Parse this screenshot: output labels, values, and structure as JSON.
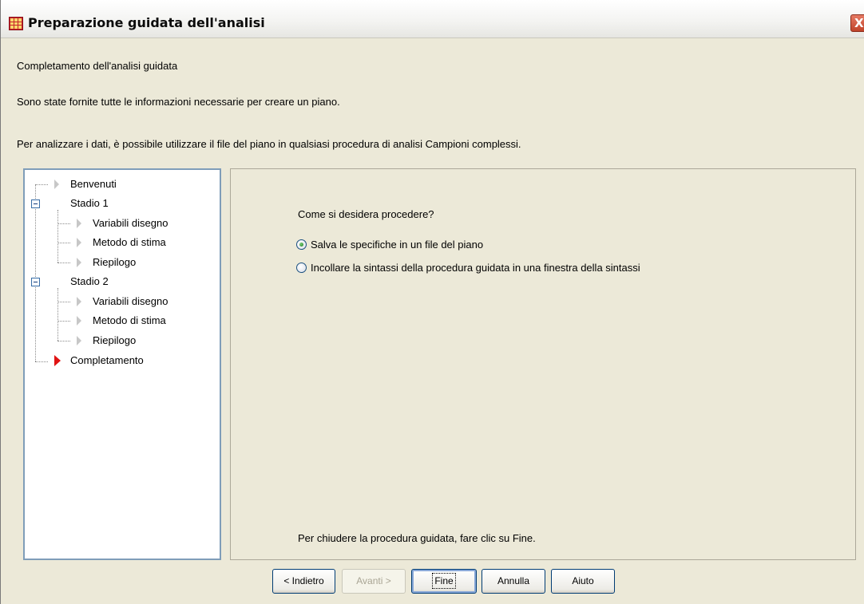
{
  "window": {
    "title": "Preparazione guidata dell'analisi",
    "close_glyph": "X"
  },
  "page": {
    "heading": "Completamento dell'analisi guidata",
    "info_line_1": "Sono state fornite tutte le informazioni necessarie per creare un piano.",
    "info_line_2": "Per analizzare i dati, è possibile utilizzare il file del piano in qualsiasi procedura di analisi Campioni complessi."
  },
  "tree": {
    "items": [
      {
        "label": "Benvenuti",
        "level": 0,
        "icon": "arrow-right-icon"
      },
      {
        "label": "Stadio 1",
        "level": 0,
        "icon": "collapse-icon"
      },
      {
        "label": "Variabili disegno",
        "level": 1,
        "icon": "arrow-right-icon"
      },
      {
        "label": "Metodo di stima",
        "level": 1,
        "icon": "arrow-right-icon"
      },
      {
        "label": "Riepilogo",
        "level": 1,
        "icon": "arrow-right-icon"
      },
      {
        "label": "Stadio 2",
        "level": 0,
        "icon": "collapse-icon"
      },
      {
        "label": "Variabili disegno",
        "level": 1,
        "icon": "arrow-right-icon"
      },
      {
        "label": "Metodo di stima",
        "level": 1,
        "icon": "arrow-right-icon"
      },
      {
        "label": "Riepilogo",
        "level": 1,
        "icon": "arrow-right-icon"
      },
      {
        "label": "Completamento",
        "level": 0,
        "icon": "arrow-right-icon",
        "active": true
      }
    ],
    "active_color": "#e01313"
  },
  "options": {
    "question": "Come si desidera procedere?",
    "choices": [
      {
        "label": "Salva le specifiche in un file del piano",
        "selected": true
      },
      {
        "label": "Incollare la sintassi della procedura guidata in una finestra della sintassi",
        "selected": false
      }
    ],
    "footer_note": "Per chiudere la procedura guidata, fare clic su Fine."
  },
  "buttons": {
    "back": "< Indietro",
    "next": "Avanti >",
    "finish": "Fine",
    "cancel": "Annulla",
    "help": "Aiuto"
  }
}
